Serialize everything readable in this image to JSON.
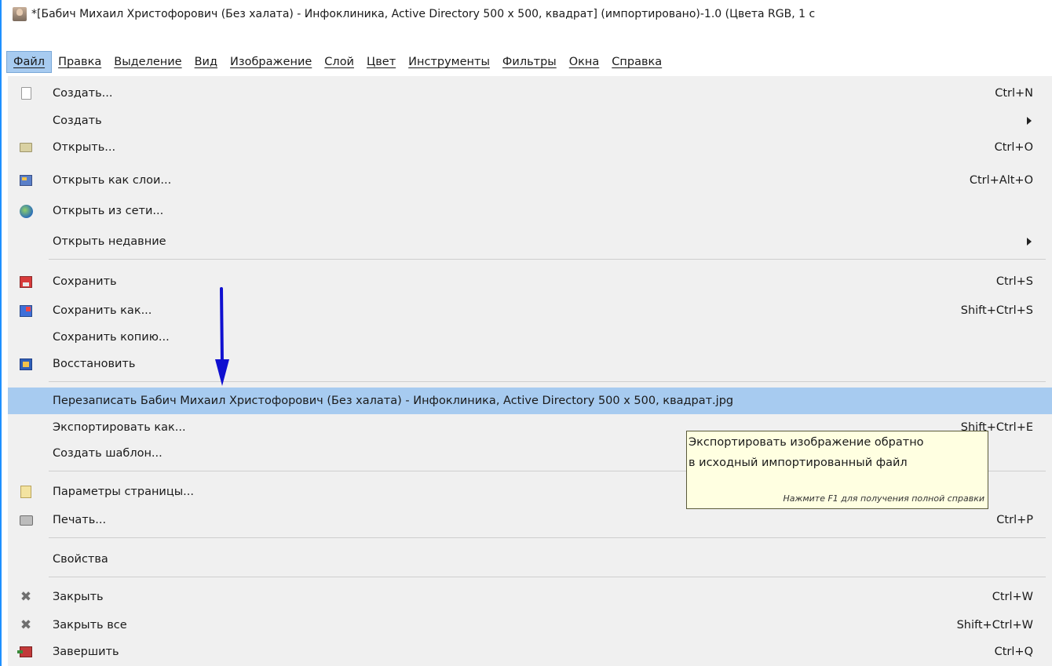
{
  "window": {
    "title": "*[Бабич Михаил Христофорович (Без халата) - Инфоклиника, Active Directory 500 x 500, квадрат] (импортировано)-1.0 (Цвета RGB, 1 с"
  },
  "menubar": [
    {
      "label": "Файл",
      "active": true
    },
    {
      "label": "Правка"
    },
    {
      "label": "Выделение"
    },
    {
      "label": "Вид"
    },
    {
      "label": "Изображение"
    },
    {
      "label": "Слой"
    },
    {
      "label": "Цвет"
    },
    {
      "label": "Инструменты"
    },
    {
      "label": "Фильтры"
    },
    {
      "label": "Окна"
    },
    {
      "label": "Справка"
    }
  ],
  "file_menu": {
    "items": [
      {
        "label": "Создать...",
        "shortcut": "Ctrl+N",
        "icon": "new-document-icon"
      },
      {
        "label": "Создать",
        "submenu": true
      },
      {
        "label": "Открыть...",
        "shortcut": "Ctrl+O",
        "icon": "folder-icon"
      },
      {
        "label": "Открыть как слои...",
        "shortcut": "Ctrl+Alt+O",
        "icon": "open-as-layers-icon"
      },
      {
        "label": "Открыть из сети...",
        "icon": "globe-icon"
      },
      {
        "label": "Открыть недавние",
        "submenu": true
      },
      {
        "label": "Сохранить",
        "shortcut": "Ctrl+S",
        "icon": "save-icon"
      },
      {
        "label": "Сохранить как...",
        "shortcut": "Shift+Ctrl+S",
        "icon": "save-as-icon"
      },
      {
        "label": "Сохранить копию..."
      },
      {
        "label": "Восстановить",
        "icon": "revert-icon"
      },
      {
        "label": "Перезаписать Бабич Михаил Христофорович (Без халата) - Инфоклиника, Active Directory 500 x 500, квадрат.jpg",
        "highlighted": true
      },
      {
        "label": "Экспортировать как...",
        "shortcut": "Shift+Ctrl+E"
      },
      {
        "label": "Создать шаблон..."
      },
      {
        "label": "Параметры страницы...",
        "icon": "page-setup-icon"
      },
      {
        "label": "Печать...",
        "shortcut": "Ctrl+P",
        "icon": "printer-icon"
      },
      {
        "label": "Свойства"
      },
      {
        "label": "Закрыть",
        "shortcut": "Ctrl+W",
        "icon": "close-icon"
      },
      {
        "label": "Закрыть все",
        "shortcut": "Shift+Ctrl+W",
        "icon": "close-all-icon"
      },
      {
        "label": "Завершить",
        "shortcut": "Ctrl+Q",
        "icon": "quit-icon"
      }
    ]
  },
  "tooltip": {
    "line1": "Экспортировать изображение обратно",
    "line2": "в исходный импортированный файл",
    "hint": "Нажмите F1 для получения полной справки"
  },
  "colors": {
    "highlight": "#a7cbf0",
    "menu_bg": "#f0f0f0",
    "tooltip_bg": "#ffffe1",
    "annotation_arrow": "#1010d0",
    "window_border": "#1e90ff"
  }
}
